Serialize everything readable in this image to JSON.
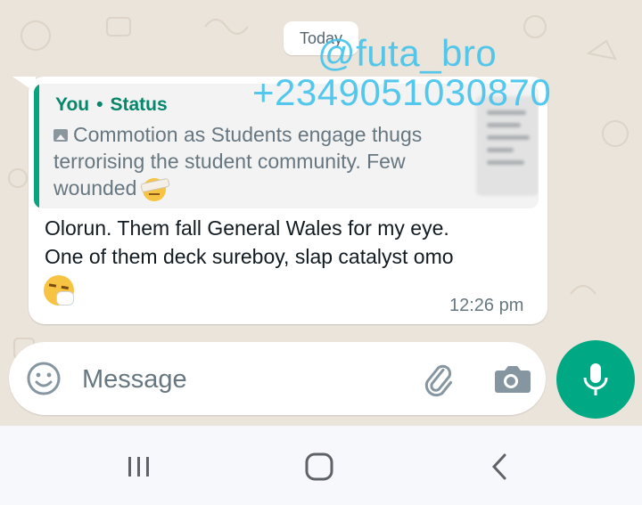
{
  "watermark": {
    "username": "@futa_bro",
    "phone": "+2349051030870"
  },
  "chat": {
    "date_chip": "Today",
    "message": {
      "quote": {
        "author": "You",
        "separator": "•",
        "source": "Status",
        "text": "Commotion as Students engage thugs terrorising the student community. Few wounded",
        "media_icon": "image-icon",
        "emoji_icon": "face-with-head-bandage-emoji"
      },
      "lines": [
        "Olorun. Them fall General Wales for my eye.",
        "One of them deck sureboy, slap catalyst omo"
      ],
      "emoji_icon": "sneezing-face-emoji",
      "time": "12:26 pm"
    }
  },
  "composer": {
    "placeholder": "Message",
    "icons": {
      "emoji": "smiley-icon",
      "attach": "paperclip-icon",
      "camera": "camera-icon",
      "mic": "microphone-icon"
    }
  },
  "navigation": {
    "icons": [
      "recent-apps-icon",
      "home-icon",
      "back-icon"
    ]
  },
  "colors": {
    "accent": "#00a884",
    "quote_author": "#06866b",
    "wallpaper": "#ebe4da",
    "watermark": "#46c3eb"
  }
}
